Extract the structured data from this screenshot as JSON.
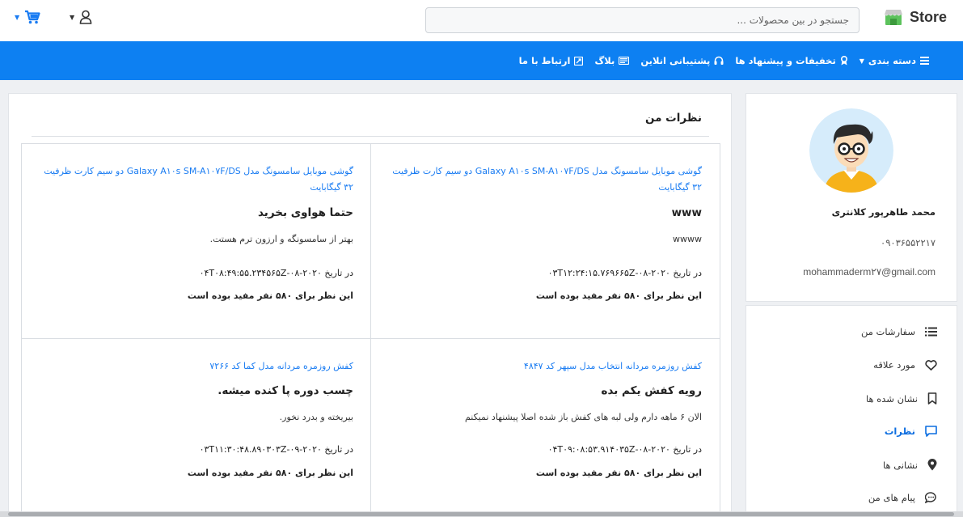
{
  "header": {
    "logo_text": "Store",
    "search_placeholder": "جستجو در بین محصولات ...",
    "icons": {
      "logo": "store-icon",
      "user": "user-icon",
      "cart": "cart-icon",
      "caret": "caret-down-icon"
    }
  },
  "nav": {
    "items": [
      {
        "label": "دسته بندی",
        "icon": "menu-bars-icon",
        "has_caret": true
      },
      {
        "label": "تخفیفات و پیشنهاد ها",
        "icon": "award-icon"
      },
      {
        "label": "پشتیبانی انلاین",
        "icon": "headset-icon"
      },
      {
        "label": "بلاگ",
        "icon": "newspaper-icon"
      },
      {
        "label": "ارتباط با ما",
        "icon": "contact-card-icon"
      }
    ],
    "color": "#0d80f2"
  },
  "profile": {
    "name": "محمد طاهرپور کلانتری",
    "phone": "۰۹۰۳۶۵۵۲۲۱۷",
    "email": "mohammaderm۲۷@gmail.com"
  },
  "menu": {
    "items": [
      {
        "label": "سفارشات من",
        "icon": "list-icon",
        "active": false
      },
      {
        "label": "مورد علاقه",
        "icon": "heart-icon",
        "active": false
      },
      {
        "label": "نشان شده ها",
        "icon": "bookmark-icon",
        "active": false
      },
      {
        "label": "نظرات",
        "icon": "comment-icon",
        "active": true
      },
      {
        "label": "نشانی ها",
        "icon": "location-pin-icon",
        "active": false
      },
      {
        "label": "پیام های من",
        "icon": "message-icon",
        "active": false
      }
    ]
  },
  "reviews": {
    "title": "نظرات من",
    "items": [
      {
        "product": "گوشی موبایل سامسونگ مدل Galaxy A۱۰s SM-A۱۰۷F/DS دو سیم کارت ظرفیت ۳۲ گیگابایت",
        "title": "www",
        "body": "wwww",
        "date": "در تاریخ ۲۰۲۰-۰۸-۰۳T۱۲:۲۴:۱۵.۷۶۹۶۶۵Z",
        "helpful": "این نظر برای ۵۸۰ نفر مفید بوده است"
      },
      {
        "product": "گوشی موبایل سامسونگ مدل Galaxy A۱۰s SM-A۱۰۷F/DS دو سیم کارت ظرفیت ۳۲ گیگابایت",
        "title": "حتما هواوی بخرید",
        "body": "بهتر از سامسونگه و ارزون ترم هستت.",
        "date": "در تاریخ ۲۰۲۰-۰۸-۰۴T۰۸:۴۹:۵۵.۲۳۴۵۶۵Z",
        "helpful": "این نظر برای ۵۸۰ نفر مفید بوده است"
      },
      {
        "product": "کفش روزمره مردانه انتخاب مدل سپهر کد ۴۸۴۷",
        "title": "رویه کفش یکم بده",
        "body": "الان ۶ ماهه دارم ولی لبه های کفش باز شده اصلا پیشنهاد نمیکنم",
        "date": "در تاریخ ۲۰۲۰-۰۸-۰۴T۰۹:۰۸:۵۳.۹۱۴۰۳۵Z",
        "helpful": "این نظر برای ۵۸۰ نفر مفید بوده است"
      },
      {
        "product": "کفش روزمره مردانه مدل کما کد ۷۲۶۶",
        "title": "چسب دوره پا کنده میشه.",
        "body": "بیریخته و بدرد نخور.",
        "date": "در تاریخ ۲۰۲۰-۰۹-۰۳T۱۱:۳۰:۴۸.۸۹۰۳۰۳Z",
        "helpful": "این نظر برای ۵۸۰ نفر مفید بوده است"
      }
    ]
  }
}
